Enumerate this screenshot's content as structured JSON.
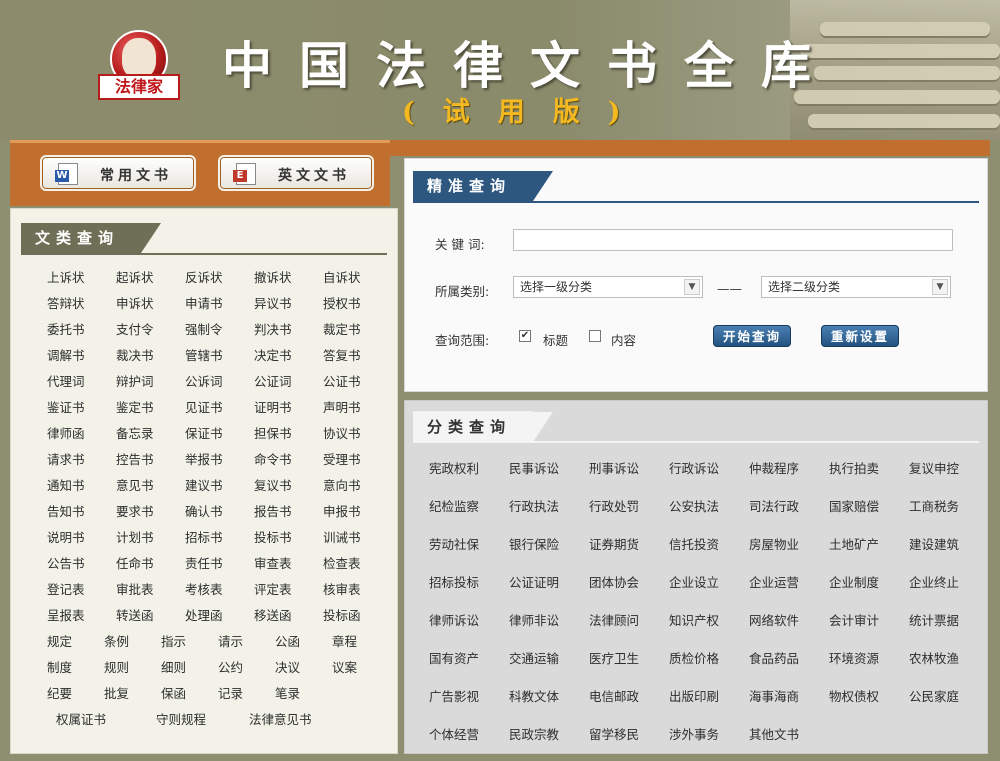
{
  "header": {
    "logo_text": "法律家",
    "title": "中国法律文书全库",
    "subtitle": "(试用版)"
  },
  "top_buttons": [
    {
      "label": "常用文书",
      "icon": "word-doc-icon",
      "icon_letter": "W"
    },
    {
      "label": "英文文书",
      "icon": "english-doc-icon",
      "icon_letter": "E"
    }
  ],
  "left_section": {
    "title": "文类查询",
    "rows": [
      [
        "上诉状",
        "起诉状",
        "反诉状",
        "撤诉状",
        "自诉状"
      ],
      [
        "答辩状",
        "申诉状",
        "申请书",
        "异议书",
        "授权书"
      ],
      [
        "委托书",
        "支付令",
        "强制令",
        "判决书",
        "裁定书"
      ],
      [
        "调解书",
        "裁决书",
        "管辖书",
        "决定书",
        "答复书"
      ],
      [
        "代理词",
        "辩护词",
        "公诉词",
        "公证词",
        "公证书"
      ],
      [
        "鉴证书",
        "鉴定书",
        "见证书",
        "证明书",
        "声明书"
      ],
      [
        "律师函",
        "备忘录",
        "保证书",
        "担保书",
        "协议书"
      ],
      [
        "请求书",
        "控告书",
        "举报书",
        "命令书",
        "受理书"
      ],
      [
        "通知书",
        "意见书",
        "建议书",
        "复议书",
        "意向书"
      ],
      [
        "告知书",
        "要求书",
        "确认书",
        "报告书",
        "申报书"
      ],
      [
        "说明书",
        "计划书",
        "招标书",
        "投标书",
        "训诫书"
      ],
      [
        "公告书",
        "任命书",
        "责任书",
        "审查表",
        "检查表"
      ],
      [
        "登记表",
        "审批表",
        "考核表",
        "评定表",
        "核审表"
      ],
      [
        "呈报表",
        "转送函",
        "处理函",
        "移送函",
        "投标函"
      ],
      [
        "规定",
        "条例",
        "指示",
        "请示",
        "公函",
        "章程"
      ],
      [
        "制度",
        "规则",
        "细则",
        "公约",
        "决议",
        "议案"
      ],
      [
        "纪要",
        "批复",
        "保函",
        "记录",
        "笔录"
      ],
      [
        "权属证书",
        "守则规程",
        "法律意见书"
      ]
    ]
  },
  "precise_query": {
    "title": "精准查询",
    "keyword_label": "关 键 词:",
    "keyword_value": "",
    "category_label": "所属类别:",
    "category1": "选择一级分类",
    "separator": "——",
    "category2": "选择二级分类",
    "scope_label": "查询范围:",
    "scope_title": "标题",
    "scope_title_checked": true,
    "scope_content": "内容",
    "scope_content_checked": false,
    "search_button": "开始查询",
    "reset_button": "重新设置"
  },
  "category_query": {
    "title": "分类查询",
    "rows": [
      [
        "宪政权利",
        "民事诉讼",
        "刑事诉讼",
        "行政诉讼",
        "仲裁程序",
        "执行拍卖",
        "复议申控"
      ],
      [
        "纪检监察",
        "行政执法",
        "行政处罚",
        "公安执法",
        "司法行政",
        "国家赔偿",
        "工商税务"
      ],
      [
        "劳动社保",
        "银行保险",
        "证券期货",
        "信托投资",
        "房屋物业",
        "土地矿产",
        "建设建筑"
      ],
      [
        "招标投标",
        "公证证明",
        "团体协会",
        "企业设立",
        "企业运营",
        "企业制度",
        "企业终止"
      ],
      [
        "律师诉讼",
        "律师非讼",
        "法律顾问",
        "知识产权",
        "网络软件",
        "会计审计",
        "统计票据"
      ],
      [
        "国有资产",
        "交通运输",
        "医疗卫生",
        "质检价格",
        "食品药品",
        "环境资源",
        "农林牧渔"
      ],
      [
        "广告影视",
        "科教文体",
        "电信邮政",
        "出版印刷",
        "海事海商",
        "物权债权",
        "公民家庭"
      ],
      [
        "个体经营",
        "民政宗教",
        "留学移民",
        "涉外事务",
        "其他文书"
      ]
    ]
  },
  "colors": {
    "header_bg": "#8c8c6c",
    "accent_orange": "#c06f2f",
    "precise_blue": "#2d577f",
    "title_gold": "#f4b820"
  }
}
